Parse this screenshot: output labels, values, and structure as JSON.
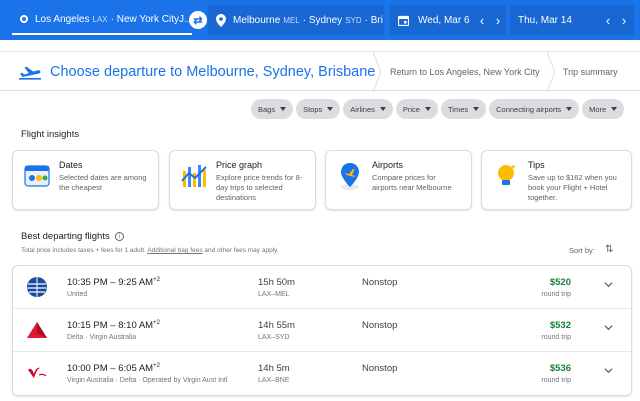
{
  "search": {
    "origin": {
      "city1": "Los Angeles",
      "code1": "LAX",
      "city2": "New York City",
      "truncation": "J…"
    },
    "destination": {
      "city1": "Melbourne",
      "code1": "MEL",
      "city2": "Sydney",
      "code2": "SYD",
      "truncation": "Bri…"
    },
    "depart_date": "Wed, Mar 6",
    "return_date": "Thu, Mar 14"
  },
  "steps": {
    "current": "Choose departure to Melbourne, Sydney, Brisbane",
    "next": "Return to Los Angeles, New York City",
    "summary": "Trip summary"
  },
  "filters": [
    "Bags",
    "Stops",
    "Airlines",
    "Price",
    "Times",
    "Connecting airports",
    "More"
  ],
  "insights": {
    "title": "Flight insights",
    "cards": [
      {
        "title": "Dates",
        "text1": "Selected dates are among",
        "text2": "the cheapest",
        "text3": ""
      },
      {
        "title": "Price graph",
        "text1": "Explore price trends for 8-",
        "text2": "day trips to selected",
        "text3": "destinations"
      },
      {
        "title": "Airports",
        "text1": "Compare prices for",
        "text2": "airports near Melbourne",
        "text3": ""
      },
      {
        "title": "Tips",
        "text1": "Save up to $162 when you",
        "text2": "book your Flight + Hotel",
        "text3": "together."
      }
    ]
  },
  "best": {
    "title": "Best departing flights",
    "subtitle_pre": "Total price includes taxes + fees for 1 adult.",
    "subtitle_link": "Additional bag fees",
    "subtitle_post": "and other fees may apply.",
    "sort_label": "Sort by:"
  },
  "flights": [
    {
      "depart": "10:35 PM",
      "arrive": "9:25 AM",
      "plus": "+2",
      "airline": "United",
      "duration": "15h 50m",
      "route": "LAX–MEL",
      "stops": "Nonstop",
      "price": "$520",
      "trip": "round trip"
    },
    {
      "depart": "10:15 PM",
      "arrive": "8:10 AM",
      "plus": "+2",
      "airline": "Delta · Virgin Australia",
      "duration": "14h 55m",
      "route": "LAX–SYD",
      "stops": "Nonstop",
      "price": "$532",
      "trip": "round trip"
    },
    {
      "depart": "10:00 PM",
      "arrive": "6:05 AM",
      "plus": "+2",
      "airline": "Virgin Australia · Delta · Operated by Virgin Aust Intl",
      "duration": "14h 5m",
      "route": "LAX–BNE",
      "stops": "Nonstop",
      "price": "$536",
      "trip": "round trip"
    }
  ],
  "colors": {
    "accent": "#1a73e8",
    "price_green": "#188038",
    "united": "#1a4a9e",
    "delta": "#e01933",
    "virgin": "#c8102e"
  }
}
